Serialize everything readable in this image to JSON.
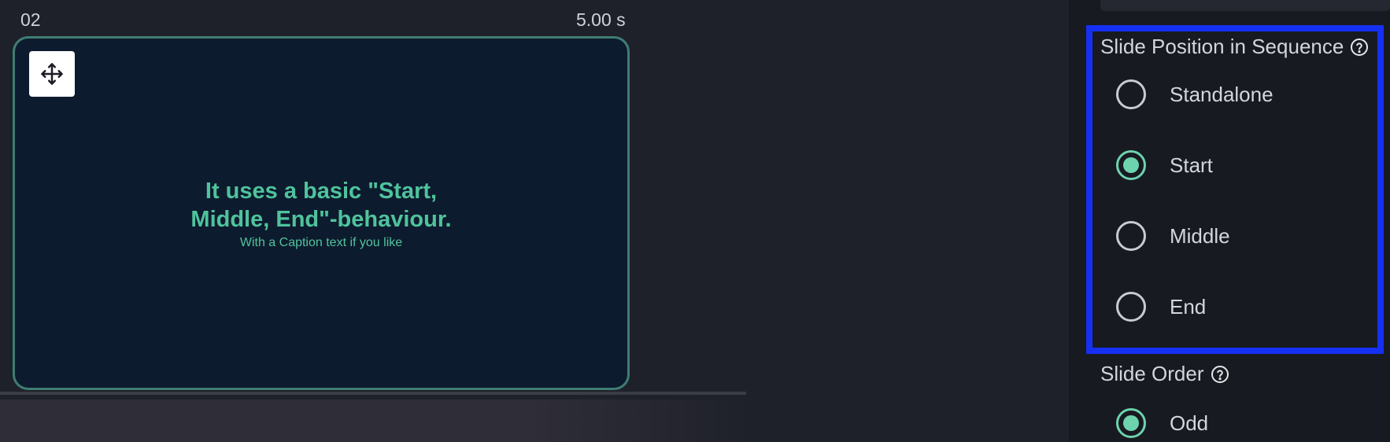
{
  "slide": {
    "index": "02",
    "duration": "5.00 s",
    "title_line1": "It uses a basic \"Start,",
    "title_line2": "Middle, End\"-behaviour.",
    "caption": "With a Caption text if you like",
    "move_icon": "move-arrows-icon"
  },
  "panel": {
    "position_section": {
      "label": "Slide Position in Sequence",
      "help_icon": "question-circle-icon",
      "options": [
        {
          "label": "Standalone",
          "checked": false
        },
        {
          "label": "Start",
          "checked": true
        },
        {
          "label": "Middle",
          "checked": false
        },
        {
          "label": "End",
          "checked": false
        }
      ]
    },
    "order_section": {
      "label": "Slide Order",
      "help_icon": "question-circle-icon",
      "options": [
        {
          "label": "Odd",
          "checked": true
        }
      ]
    }
  },
  "colors": {
    "accent": "#6dd3ae",
    "slide_text": "#4fc39c",
    "slide_bg": "#0d1b2e",
    "slide_border": "#3f7d72",
    "focus_outline": "#1530f2"
  }
}
